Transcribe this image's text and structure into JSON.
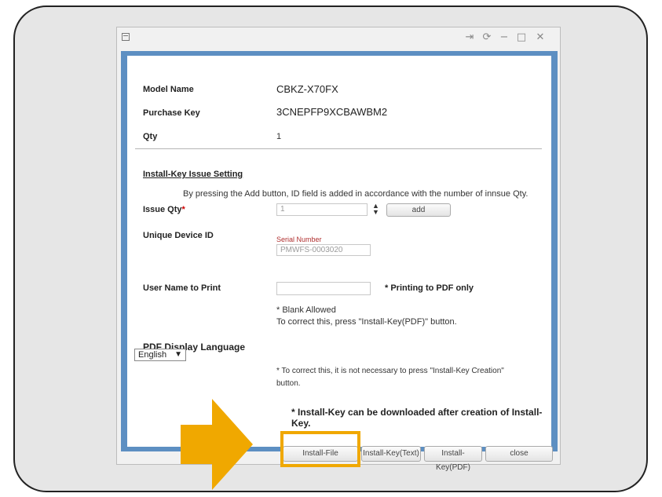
{
  "window": {
    "pin_icon": "⇥",
    "refresh_icon": "⟳",
    "minimize_icon": "−",
    "maximize_icon": "□",
    "close_icon": "✕"
  },
  "info": {
    "model_name_label": "Model Name",
    "model_name_value": "CBKZ-X70FX",
    "purchase_key_label": "Purchase Key",
    "purchase_key_value": "3CNEPFP9XCBAWBM2",
    "qty_label": "Qty",
    "qty_value": "1"
  },
  "install_key": {
    "section_title": "Install-Key Issue Setting",
    "instruction": "By pressing the Add button, ID field is added in accordance with the number of innsue Qty.",
    "issue_qty_label": "Issue Qty",
    "required_mark": "*",
    "issue_qty_value": "1",
    "add_button": "add",
    "unique_device_id_label": "Unique Device ID",
    "serial_number_label": "Serial Number",
    "serial_number_value": "PMWFS-0003020",
    "user_name_label": "User Name to Print",
    "user_name_value": "",
    "printing_note": "* Printing to PDF only",
    "blank_allowed": "* Blank Allowed",
    "correct_note_1": "To correct this, press \"Install-Key(PDF)\" button.",
    "pdf_language_label": "PDF Display Language",
    "pdf_language_value": "English",
    "correct_note_2_line1": "* To correct this, it is not necessary to press \"Install-Key Creation\"",
    "correct_note_2_line2": "button.",
    "download_note": "* Install-Key can be downloaded after creation of Install-Key."
  },
  "footer": {
    "install_file": "Install-File",
    "install_key_text": "Install-Key(Text)",
    "install_key_pdf": "Install-Key(PDF)",
    "close": "close"
  },
  "colors": {
    "highlight": "#f0a800",
    "window_border": "#5d8fc2",
    "required": "#cc0000"
  }
}
